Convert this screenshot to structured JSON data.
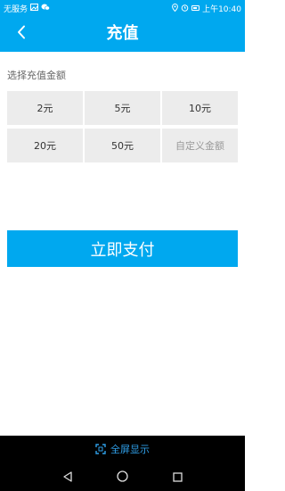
{
  "status_bar": {
    "carrier": "无服务",
    "time": "上午10:40",
    "left_icons": [
      "image-icon",
      "wechat-icon"
    ],
    "right_icons": [
      "location-icon",
      "alarm-icon",
      "battery-icon"
    ]
  },
  "header": {
    "back_icon": "back-arrow-icon",
    "title": "充值"
  },
  "recharge": {
    "section_label": "选择充值金额",
    "amounts": [
      {
        "label": "2元"
      },
      {
        "label": "5元"
      },
      {
        "label": "10元"
      },
      {
        "label": "20元"
      },
      {
        "label": "50元"
      },
      {
        "label": "自定义金额"
      }
    ]
  },
  "pay_button": {
    "label": "立即支付"
  },
  "fullscreen": {
    "icon": "fullscreen-icon",
    "label": "全屏显示"
  },
  "nav": {
    "buttons": [
      "back-triangle-icon",
      "home-circle-icon",
      "recents-square-icon"
    ]
  },
  "colors": {
    "accent": "#00a8ef",
    "cell_bg": "#ececec",
    "fullscreen_text": "#2f9fe8"
  }
}
